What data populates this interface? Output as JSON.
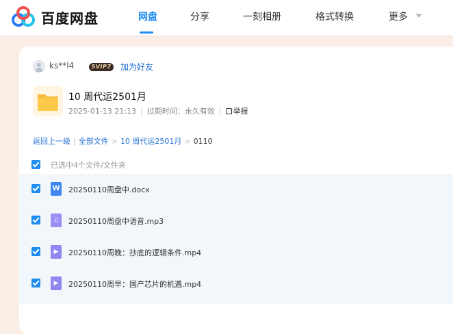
{
  "app": {
    "brand": "百度网盘"
  },
  "nav": {
    "items": [
      {
        "label": "网盘",
        "active": true
      },
      {
        "label": "分享",
        "active": false
      },
      {
        "label": "一刻相册",
        "active": false
      },
      {
        "label": "格式转换",
        "active": false
      },
      {
        "label": "更多",
        "active": false
      }
    ]
  },
  "owner": {
    "username": "ks**l4",
    "badge": "SVIP7",
    "add_friend": "加为好友"
  },
  "share": {
    "title": "10 周代运2501月",
    "date": "2025-01-13 21:13",
    "expire_label": "过期时间：永久有效",
    "report": "举报"
  },
  "breadcrumb": {
    "back": "返回上一级",
    "all_files": "全部文件",
    "folder": "10 周代运2501月",
    "current": "0110"
  },
  "selection": {
    "text": "已选中4个文件/文件夹"
  },
  "files": [
    {
      "name": "20250110周盘中.docx",
      "type": "doc",
      "checked": true
    },
    {
      "name": "20250110周盘中语音.mp3",
      "type": "audio",
      "checked": true
    },
    {
      "name": "20250110周晚：抄底的逻辑条件.mp4",
      "type": "video",
      "checked": true
    },
    {
      "name": "20250110周早：国产芯片的机遇.mp4",
      "type": "video",
      "checked": true
    }
  ],
  "colors": {
    "accent": "#1f8cf1",
    "link": "#1f6ed4",
    "page_bg": "#fbeee6",
    "list_bg": "#f2f7fc"
  }
}
